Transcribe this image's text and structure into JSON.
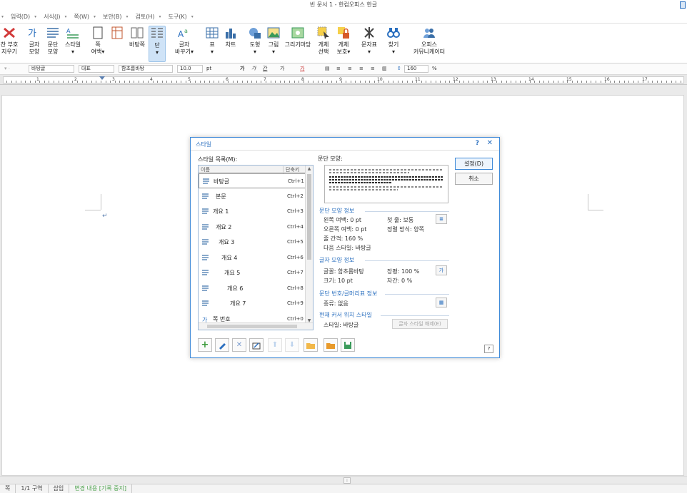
{
  "app": {
    "window_title": "빈 문서 1 - 한컴오피스 한글"
  },
  "menu": {
    "items": [
      "입력(D)",
      "서식(J)",
      "쪽(W)",
      "보안(B)",
      "검토(H)",
      "도구(K)"
    ]
  },
  "ribbon": {
    "buttons": [
      {
        "label": "찬 부호",
        "sub": "지우기",
        "icon": "clear-mark-icon"
      },
      {
        "label": "글자",
        "sub": "모양",
        "icon": "char-shape-icon"
      },
      {
        "label": "문단",
        "sub": "모양",
        "icon": "para-shape-icon"
      },
      {
        "label": "스타일",
        "sub": "▾",
        "icon": "style-icon"
      },
      {
        "label": "쪽",
        "sub": "여백▾",
        "icon": "page-margin-icon"
      },
      {
        "label": "바탕쪽",
        "sub": "",
        "icon": "master-page-icon"
      },
      {
        "label": "단",
        "sub": "▾",
        "icon": "columns-icon"
      },
      {
        "label": "글자",
        "sub": "바꾸기▾",
        "icon": "change-char-icon"
      },
      {
        "label": "표",
        "sub": "▾",
        "icon": "table-icon"
      },
      {
        "label": "차트",
        "sub": "",
        "icon": "chart-icon"
      },
      {
        "label": "도형",
        "sub": "▾",
        "icon": "shape-icon"
      },
      {
        "label": "그림",
        "sub": "▾",
        "icon": "picture-icon"
      },
      {
        "label": "그리기마당",
        "sub": "",
        "icon": "clipart-icon"
      },
      {
        "label": "개체",
        "sub": "선택",
        "icon": "object-select-icon"
      },
      {
        "label": "개체",
        "sub": "보호▾",
        "icon": "object-protect-icon"
      },
      {
        "label": "문자표",
        "sub": "▾",
        "icon": "symbol-icon"
      },
      {
        "label": "찾기",
        "sub": "▾",
        "icon": "find-icon"
      },
      {
        "label": "오피스",
        "sub": "커뮤니케이터",
        "icon": "communicator-icon"
      }
    ]
  },
  "format_bar": {
    "style": "바탕글",
    "lang": "대표",
    "font": "함초롬바탕",
    "size": "10.0",
    "size_unit": "pt",
    "bold": "가",
    "italic": "가",
    "underline": "간",
    "strike": "가",
    "color": "가",
    "line_spacing": "160",
    "line_unit": "%"
  },
  "ruler": {
    "numbers": [
      "1",
      "2",
      "3",
      "4",
      "5",
      "6",
      "7",
      "8",
      "9",
      "10",
      "11",
      "12",
      "13",
      "14",
      "15",
      "16",
      "17"
    ]
  },
  "document": {
    "para_mark": "↵"
  },
  "status": {
    "items": [
      "1/1 구역",
      "삽입",
      "변경 내용 [기록 중지]"
    ],
    "left_cut": "쪽"
  },
  "dialog": {
    "title": "스타일",
    "help": "?",
    "close": "✕",
    "list_label": "스타일 목록(M):",
    "col_name": "이름",
    "col_shortcut": "단축키",
    "styles": [
      {
        "name": "바탕글",
        "shortcut": "Ctrl+1",
        "indent": 0,
        "kind": "para",
        "selected": true
      },
      {
        "name": "본문",
        "shortcut": "Ctrl+2",
        "indent": 1,
        "kind": "para",
        "selected": false
      },
      {
        "name": "개요 1",
        "shortcut": "Ctrl+3",
        "indent": 0,
        "kind": "para",
        "selected": false
      },
      {
        "name": "개요 2",
        "shortcut": "Ctrl+4",
        "indent": 1,
        "kind": "para",
        "selected": false
      },
      {
        "name": "개요 3",
        "shortcut": "Ctrl+5",
        "indent": 2,
        "kind": "para",
        "selected": false
      },
      {
        "name": "개요 4",
        "shortcut": "Ctrl+6",
        "indent": 3,
        "kind": "para",
        "selected": false
      },
      {
        "name": "개요 5",
        "shortcut": "Ctrl+7",
        "indent": 4,
        "kind": "para",
        "selected": false
      },
      {
        "name": "개요 6",
        "shortcut": "Ctrl+8",
        "indent": 5,
        "kind": "para",
        "selected": false
      },
      {
        "name": "개요 7",
        "shortcut": "Ctrl+9",
        "indent": 6,
        "kind": "para",
        "selected": false
      },
      {
        "name": "쪽 번호",
        "shortcut": "Ctrl+0",
        "indent": 0,
        "kind": "char",
        "selected": false
      }
    ],
    "preview_label": "문단 모양:",
    "para_info_title": "문단 모양 정보",
    "para_info": {
      "left_margin": "왼쪽 여백: 0 pt",
      "first_line": "첫 줄: 보통",
      "right_margin": "오른쪽 여백: 0 pt",
      "align": "정렬 방식: 양쪽",
      "line_spacing": "줄 간격: 160 %",
      "next_style": "다음 스타일: 바탕글"
    },
    "char_info_title": "글자 모양 정보",
    "char_info": {
      "font": "글꼴: 함초롬바탕",
      "ratio": "장평: 100 %",
      "size": "크기: 10 pt",
      "spacing": "자간: 0 %"
    },
    "numbering_title": "문단 번호/글머리표 정보",
    "numbering": {
      "kind": "종류: 없음"
    },
    "cursor_title": "현재 커서 위치 스타일",
    "cursor_style": "스타일: 바탕글",
    "release_button": "글자 스타일 해제(E)",
    "ok_button": "설정(D)",
    "cancel_button": "취소",
    "bottom_help": "?"
  },
  "colors": {
    "accent": "#2a6fbf",
    "dialog_border": "#3f8ad8",
    "track_changes": "#4aa04a"
  }
}
